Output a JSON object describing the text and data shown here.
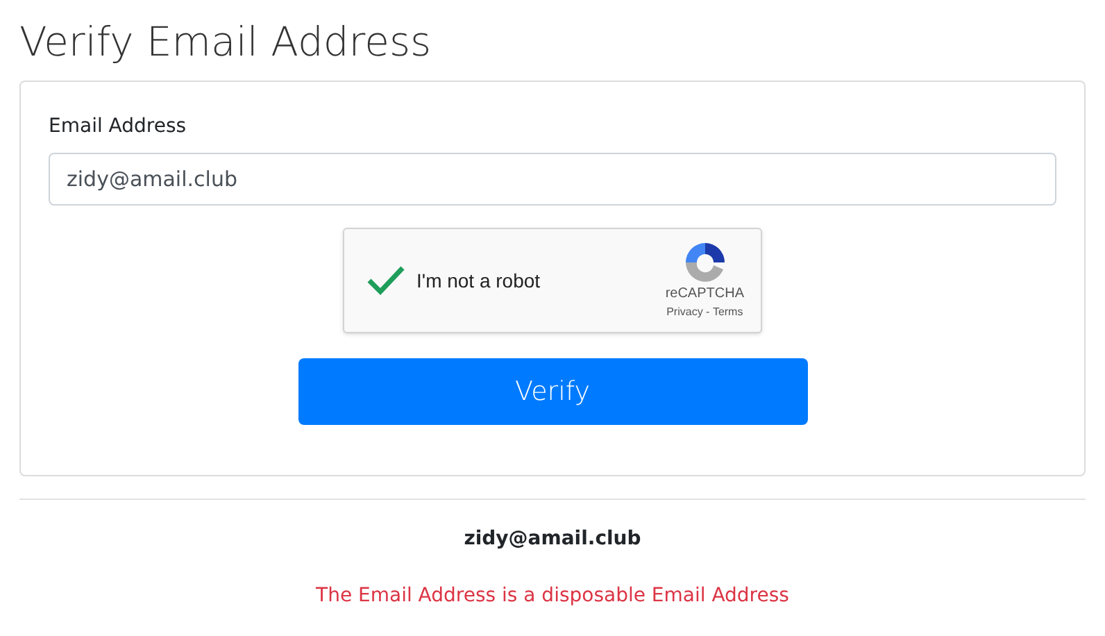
{
  "title": "Verify Email Address",
  "form": {
    "label": "Email Address",
    "value": "zidy@amail.club"
  },
  "captcha": {
    "checked": true,
    "label": "I'm not a robot",
    "brand": "reCAPTCHA",
    "privacy": "Privacy",
    "separator": " - ",
    "terms": "Terms"
  },
  "button": "Verify",
  "result": {
    "email": "zidy@amail.club",
    "message": "The Email Address is a disposable Email Address"
  }
}
